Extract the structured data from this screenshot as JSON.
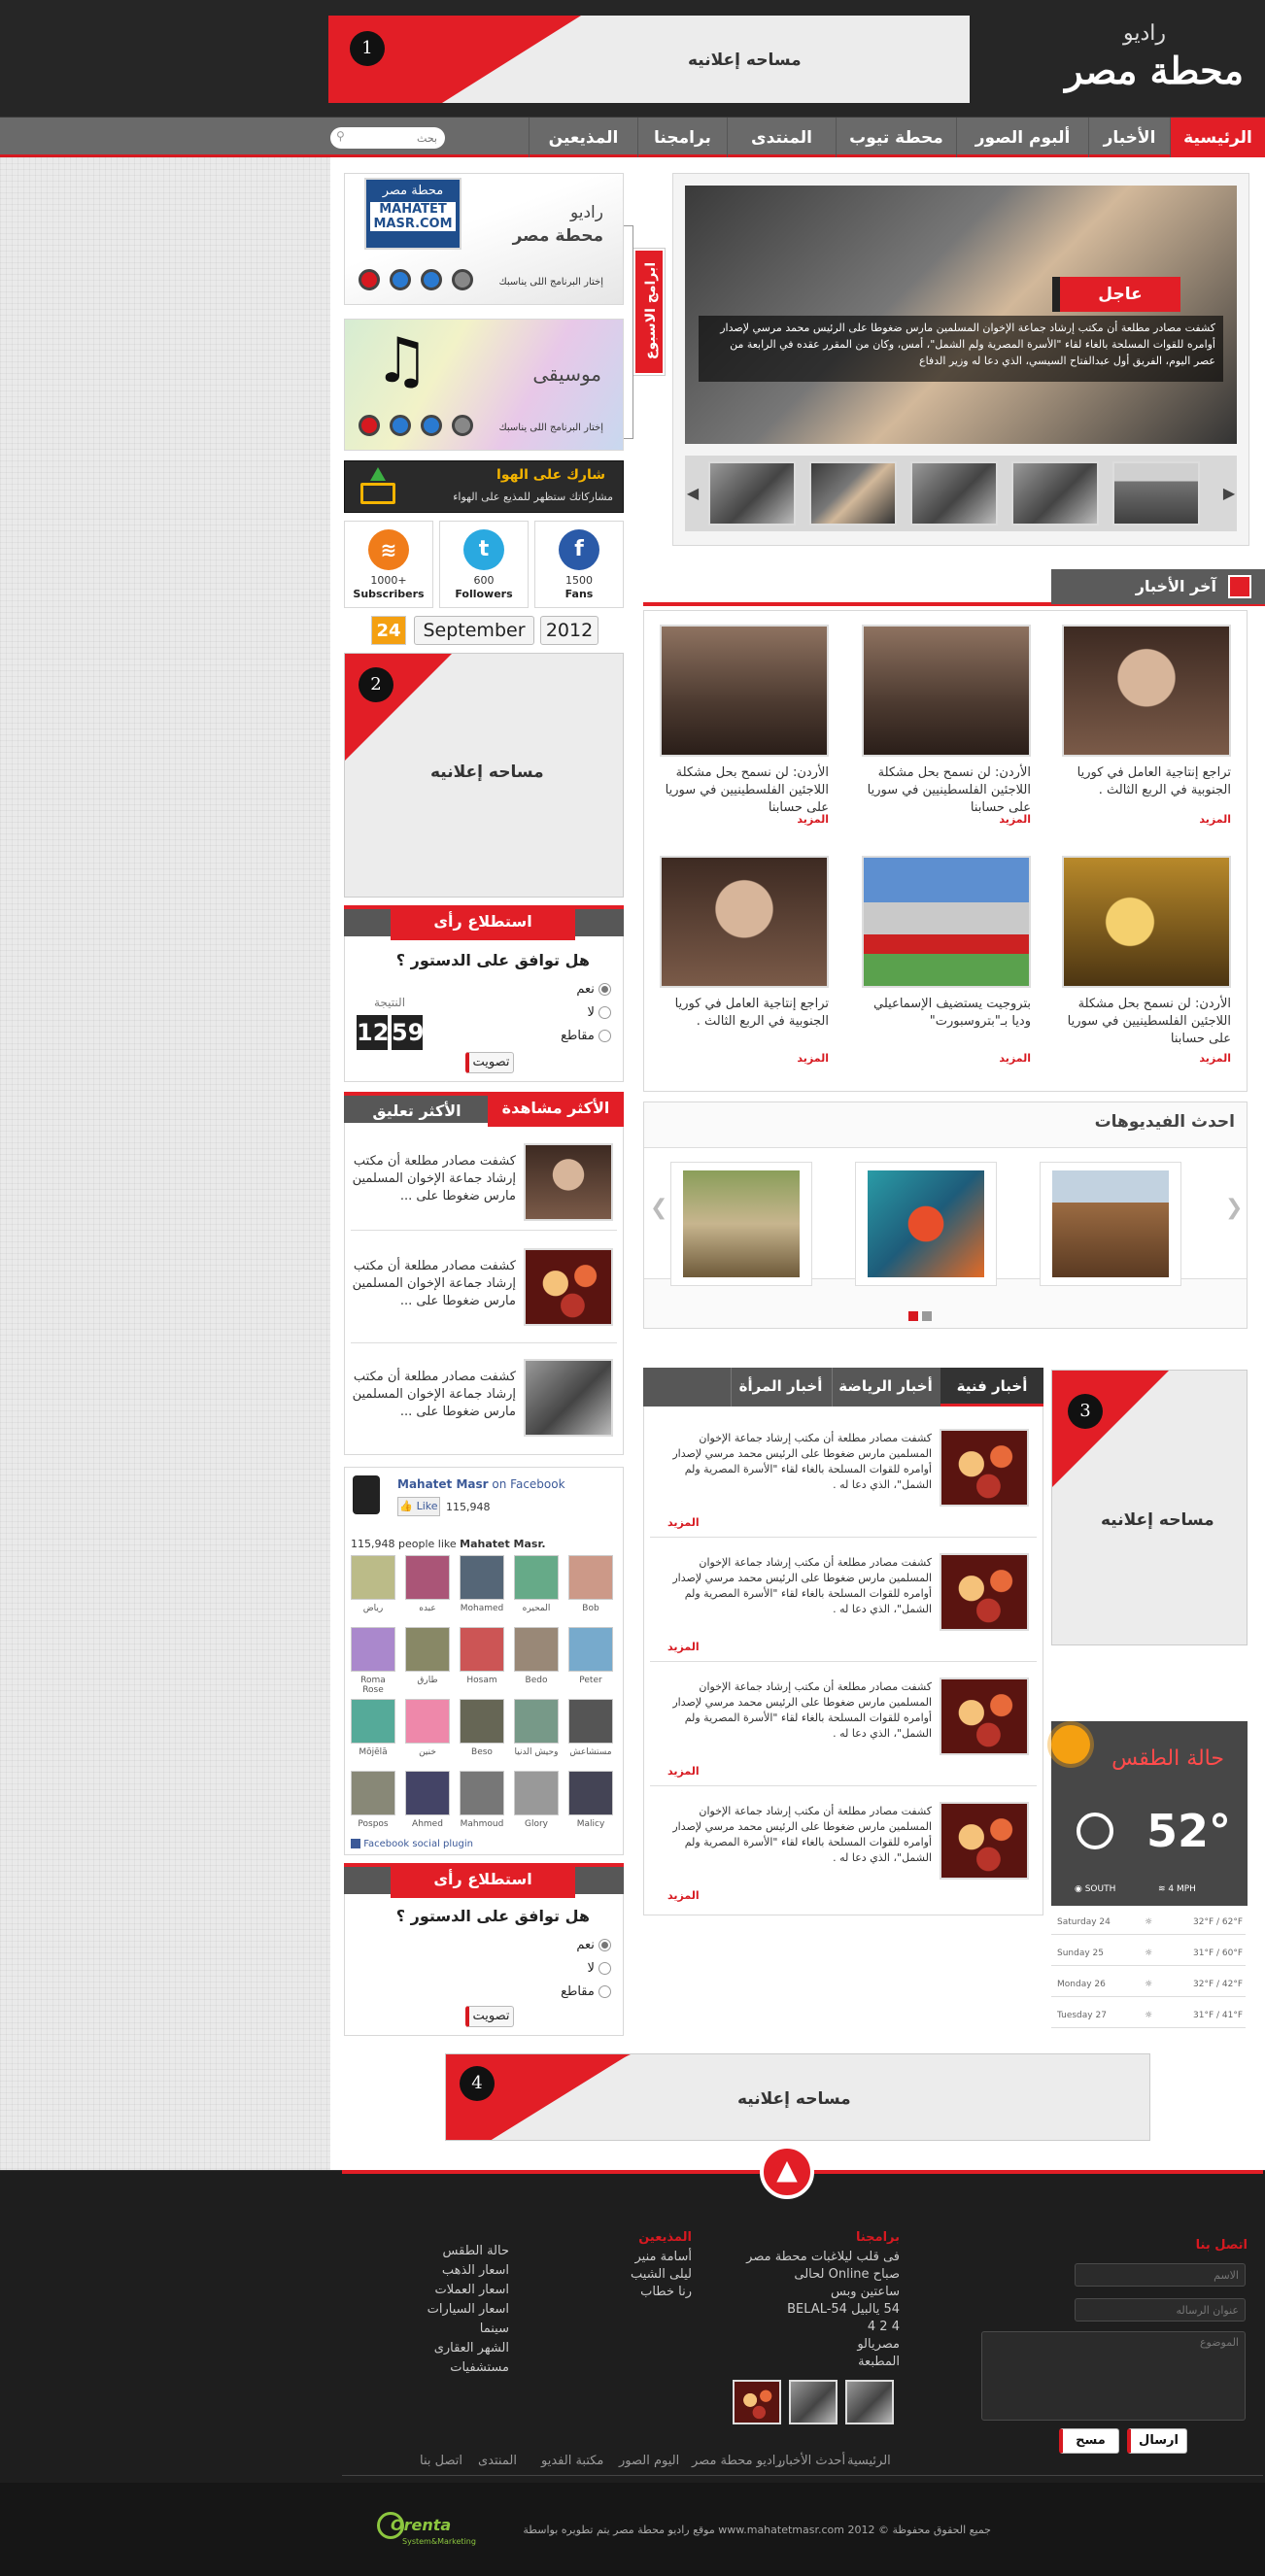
{
  "header": {
    "logo_small": "راديو",
    "logo_main": "محطة مصر",
    "ad1_number": "1",
    "ad1_text": "مساحه إعلانيه"
  },
  "nav": {
    "items": [
      "الرئيسية",
      "الأخبار",
      "ألبوم الصور",
      "محطة تيوب",
      "المنتدى",
      "برامجنا",
      "المذيعين"
    ],
    "search_placeholder": "بحث"
  },
  "radio_widget": {
    "logo_line1": "محطة مصر",
    "logo_line2": "MAHATET",
    "logo_line3": "MASR.COM",
    "title1": "راديو",
    "title2": "محطة مصر",
    "choose": "إختار البرنامج اللى يناسبك"
  },
  "music_widget": {
    "title": "موسيقى",
    "choose": "إختار البرنامج اللى يناسبك"
  },
  "side_tab": "ابرامج الاسبوع",
  "share_widget": {
    "title": "شارك على الهوا",
    "subtitle": "مشاركاتك ستظهر للمذيع على الهواء"
  },
  "social": [
    {
      "count": "1000+",
      "label": "Subscribers",
      "icon": "rss-icon",
      "color": "#f07c1a"
    },
    {
      "count": "600",
      "label": "Followers",
      "icon": "twitter-icon",
      "color": "#2aa9e0"
    },
    {
      "count": "1500",
      "label": "Fans",
      "icon": "facebook-icon",
      "color": "#2a5aa8"
    }
  ],
  "date": {
    "day": "24",
    "month": "September",
    "year": "2012"
  },
  "ad2": {
    "number": "2",
    "text": "مساحه إعلانيه"
  },
  "poll1": {
    "heading": "استطلاع رأى",
    "question": "هل توافق على الدستور ؟",
    "options": [
      "نعم",
      "لا",
      "مقاطع"
    ],
    "result_label": "النتيجة",
    "digits": [
      "12",
      "59"
    ],
    "vote": "تصويت"
  },
  "most_tabs": {
    "active": "الأكثر مشاهدة",
    "inactive": "الأكثر تعليق"
  },
  "most_items": [
    "كشفت مصادر مطلعة أن مكتب إرشاد جماعة الإخوان المسلمين مارس ضغوطا على ...",
    "كشفت مصادر مطلعة أن مكتب إرشاد جماعة الإخوان المسلمين مارس ضغوطا على ...",
    "كشفت مصادر مطلعة أن مكتب إرشاد جماعة الإخوان المسلمين مارس ضغوطا على ..."
  ],
  "facebook": {
    "page_name": "Mahatet Masr",
    "on_fb": "on Facebook",
    "like": "Like",
    "like_count": "115,948",
    "people_like_prefix": "115,948 people like",
    "people_like_name": "Mahatet Masr.",
    "names": [
      "Bob",
      "المحيره",
      "Mohamed",
      "عبده",
      "رياض",
      "Peter",
      "Bedo",
      "Hosam",
      "طارق",
      "Roma Rose",
      "مستشاعش",
      "وحيش الدنيا",
      "Beso",
      "خنين",
      "Mōjēlā",
      "Malicy",
      "Glory",
      "Mahmoud",
      "Ahmed",
      "Pospos"
    ],
    "plugin": "Facebook social plugin"
  },
  "poll2": {
    "heading": "استطلاع رأى",
    "question": "هل توافق على الدستور ؟",
    "options": [
      "نعم",
      "لا",
      "مقاطع"
    ],
    "vote": "تصويت"
  },
  "featured": {
    "badge": "عاجل",
    "text": "كشفت مصادر مطلعة أن مكتب إرشاد جماعة الإخوان المسلمين مارس ضغوطا على الرئيس محمد مرسي لإصدار أوامره للقوات المسلحة بالغاء لقاء \"الأسرة المصرية ولم الشمل\"، أمس، وكان من المقرر عقده في الرابعة من عصر اليوم، الفريق أول عبدالفتاح السيسي، الذي دعا له وزير الدفاع"
  },
  "latest": {
    "heading": "آخر الأخبار",
    "more": "المزيد",
    "items": [
      "تراجع إنتاجية العامل في كوريا الجنوبية في الربع الثالث .",
      "الأردن: لن نسمح بحل مشكلة اللاجئين الفلسطينيين في سوريا على حسابنا",
      "الأردن: لن نسمح بحل مشكلة اللاجئين الفلسطينيين في سوريا على حسابنا",
      "الأردن: لن نسمح بحل مشكلة اللاجئين الفلسطينيين في سوريا على حسابنا",
      "بتروجيت يستضيف الإسماعيلي وديا بـ\"بتروسبورت\"",
      "تراجع إنتاجية العامل في كوريا الجنوبية في الربع الثالث ."
    ]
  },
  "videos": {
    "heading": "احدث الفيديوهات"
  },
  "tabs_news": {
    "tabs": [
      "أخبار فنية",
      "أخبار الرياضة",
      "أخبار المرأة"
    ],
    "more": "المزيد",
    "item": "كشفت مصادر مطلعة أن مكتب إرشاد جماعة الإخوان المسلمين مارس ضغوطا على الرئيس محمد مرسي لإصدار أوامره للقوات المسلحة بالغاء لقاء \"الأسرة المصرية ولم الشمل\"، الذي دعا له ."
  },
  "ad3": {
    "number": "3",
    "text": "مساحه إعلانيه"
  },
  "weather": {
    "title": "حالة الطقس",
    "temp": "52°",
    "wind_dir": "SOUTH",
    "wind_speed": "4 MPH",
    "days": [
      {
        "day": "Saturday 24",
        "range": "32°F / 62°F"
      },
      {
        "day": "Sunday 25",
        "range": "31°F / 60°F"
      },
      {
        "day": "Monday 26",
        "range": "32°F / 42°F"
      },
      {
        "day": "Tuesday 27",
        "range": "31°F / 41°F"
      }
    ]
  },
  "ad4": {
    "number": "4",
    "text": "مساحه إعلانيه"
  },
  "footer": {
    "contact_heading": "اتصل بنا",
    "name_placeholder": "الاسم",
    "email_placeholder": "عنوان الرساله",
    "message_placeholder": "الموضوع",
    "send": "ارسال",
    "clear": "مسح",
    "programs_heading": "برامجنا",
    "programs": [
      "فى قلب ليلاغبات محطة مصر",
      "صباح Online لحالى",
      "ساعتين وبس",
      "54 يالبيل BELAL-54",
      "4 2 4",
      "مصريالو",
      "المطبعة"
    ],
    "hosts_heading": "المذيعين",
    "hosts": [
      "أسامة منير",
      "ليلى الشيب",
      "رنا خطاب"
    ],
    "links": [
      "حالة الطقس",
      "اسعار الذهب",
      "اسعار العملات",
      "اسعار السيارات",
      "سينما",
      "الشهر العقارى",
      "مستشفيات"
    ],
    "menu": [
      "الرئيسية",
      "أحدث الأخبار",
      "راديو محطة مصر",
      "اليوم الصور",
      "مكتبة الفديو",
      "المنتدى",
      "اتصل بنا"
    ],
    "copyright": "جميع الحقوق محفوظة © 2012 www.mahatetmasr.com موقع راديو محطة مصر يتم تطويره بواسطة",
    "dev_name": "Orenta",
    "dev_sub": "System&Marketing"
  }
}
